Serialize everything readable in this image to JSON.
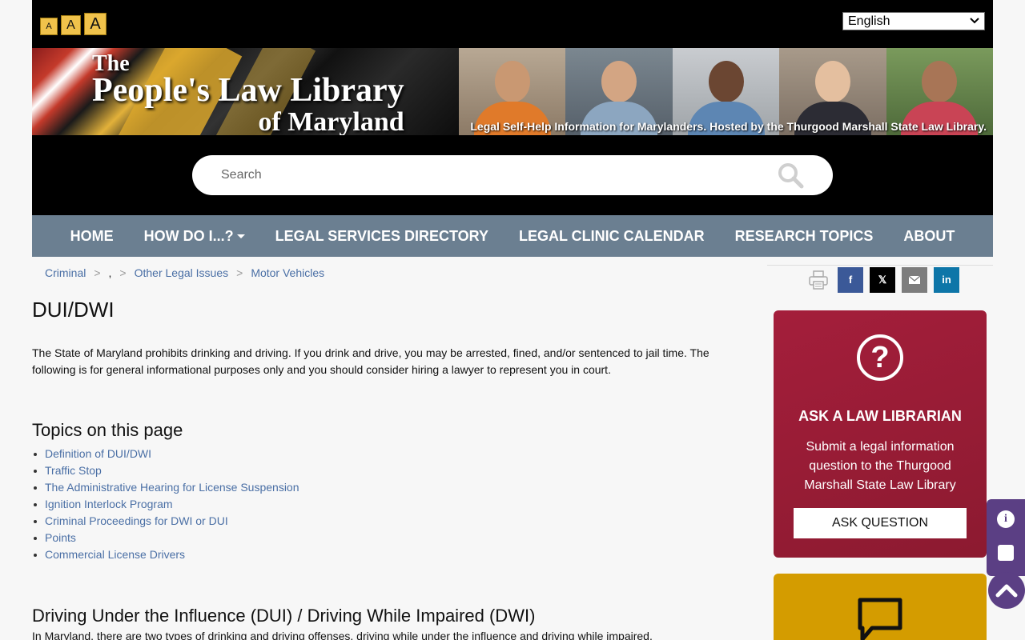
{
  "header": {
    "font_sizes": [
      "A",
      "A",
      "A"
    ],
    "language": "English"
  },
  "banner": {
    "logo_line1": "The",
    "logo_line2": "People's Law Library",
    "logo_line3": "of Maryland",
    "tagline": "Legal Self-Help Information for Marylanders. Hosted by the Thurgood Marshall State Law Library."
  },
  "search": {
    "placeholder": "Search"
  },
  "nav": {
    "items": [
      "HOME",
      "HOW DO I...?",
      "LEGAL SERVICES DIRECTORY",
      "LEGAL CLINIC CALENDAR",
      "RESEARCH TOPICS",
      "ABOUT"
    ]
  },
  "breadcrumb": {
    "items": [
      "Criminal",
      ",",
      "Other Legal Issues",
      "Motor Vehicles"
    ],
    "separator": ">"
  },
  "page": {
    "title": "DUI/DWI",
    "intro": "The State of Maryland prohibits drinking and driving. If you drink and drive, you may be arrested, fined, and/or sentenced to jail time. The following is for general informational purposes only and you should consider hiring a lawyer to represent you in court.",
    "topics_heading": "Topics on this page",
    "topics": [
      "Definition of DUI/DWI",
      "Traffic Stop",
      "The Administrative Hearing for License Suspension",
      "Ignition Interlock Program",
      "Criminal Proceedings for DWI or DUI",
      "Points",
      "Commercial License Drivers"
    ],
    "section_heading": "Driving Under the Influence (DUI) / Driving While Impaired (DWI)",
    "section_text": "In Maryland, there are two types of drinking and driving offenses, driving while under the influence and driving while impaired."
  },
  "share": {
    "icons": [
      "print-icon",
      "facebook-icon",
      "x-icon",
      "email-icon",
      "linkedin-icon"
    ],
    "facebook": "f",
    "x": "𝕏",
    "linkedin": "in"
  },
  "ask": {
    "heading": "ASK A LAW LIBRARIAN",
    "text": "Submit a legal information question to the Thurgood Marshall State Law Library",
    "button": "ASK QUESTION",
    "icon": "?"
  },
  "colors": {
    "nav_bg": "#6b7f91",
    "ask_bg": "#a41e3b",
    "chat_bg": "#d49c00",
    "link": "#4a6fa5",
    "widget": "#5b3f84"
  }
}
